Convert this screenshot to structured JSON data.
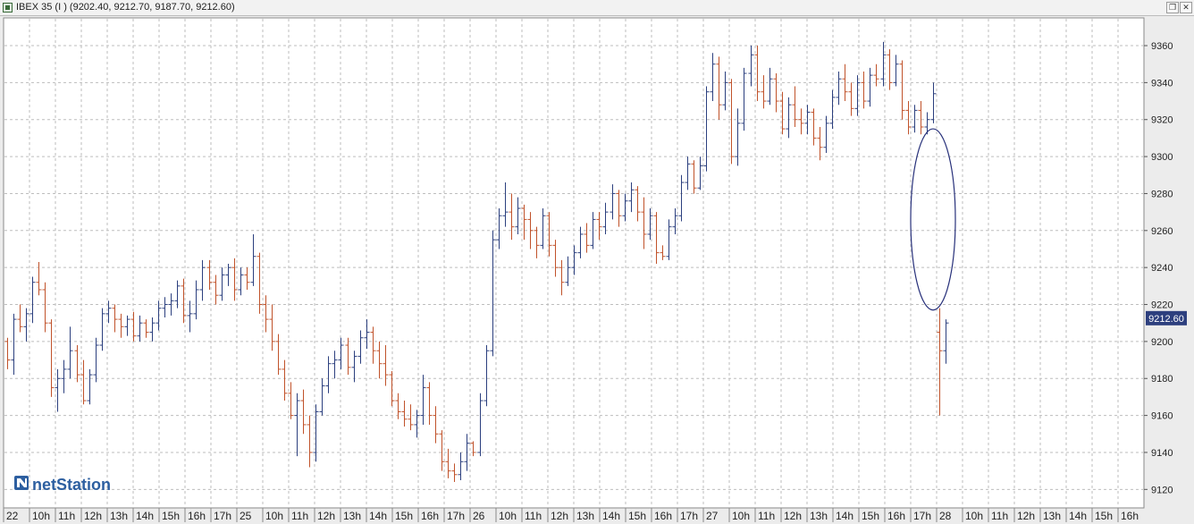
{
  "window": {
    "title": "IBEX 35 (I ) (9202.40, 9212.70, 9187.70, 9212.60)",
    "restore_glyph": "❐",
    "close_glyph": "✕"
  },
  "brand": {
    "name": "netStation",
    "icon": "netstation-n-logo"
  },
  "colors": {
    "up": "#2b3f7e",
    "down": "#c0522a",
    "grid": "#bdbdbd",
    "ellipse": "#27307a",
    "price_tag_bg": "#2d3f7e"
  },
  "chart_data": {
    "type": "ohlc-bar",
    "ylim": [
      9110,
      9375
    ],
    "y_ticks": [
      9120,
      9140,
      9160,
      9180,
      9200,
      9220,
      9240,
      9260,
      9280,
      9300,
      9320,
      9340,
      9360
    ],
    "y_tick_labels": [
      "9120",
      "9140",
      "9160",
      "9180",
      "9200",
      "9220",
      "9240",
      "9260",
      "9280",
      "9300",
      "9320",
      "9340",
      "9360"
    ],
    "last_price": "9212.60",
    "last_price_value": 9212.6,
    "x_labels": [
      "22",
      "10h",
      "11h",
      "12h",
      "13h",
      "14h",
      "15h",
      "16h",
      "17h",
      "25",
      "10h",
      "11h",
      "12h",
      "13h",
      "14h",
      "15h",
      "16h",
      "17h",
      "26",
      "10h",
      "11h",
      "12h",
      "13h",
      "14h",
      "15h",
      "16h",
      "17h",
      "27",
      "10h",
      "11h",
      "12h",
      "13h",
      "14h",
      "15h",
      "16h",
      "17h",
      "28",
      "10h",
      "11h",
      "12h",
      "13h",
      "14h",
      "15h",
      "16h"
    ],
    "grid": true,
    "bars": [
      [
        9200,
        9202,
        9185,
        9190
      ],
      [
        9190,
        9215,
        9182,
        9212
      ],
      [
        9212,
        9220,
        9205,
        9208
      ],
      [
        9208,
        9218,
        9200,
        9215
      ],
      [
        9215,
        9235,
        9210,
        9232
      ],
      [
        9232,
        9243,
        9225,
        9228
      ],
      [
        9228,
        9232,
        9205,
        9210
      ],
      [
        9210,
        9212,
        9170,
        9175
      ],
      [
        9175,
        9185,
        9162,
        9180
      ],
      [
        9180,
        9190,
        9172,
        9185
      ],
      [
        9185,
        9208,
        9180,
        9195
      ],
      [
        9195,
        9198,
        9178,
        9182
      ],
      [
        9182,
        9190,
        9166,
        9168
      ],
      [
        9168,
        9185,
        9166,
        9182
      ],
      [
        9182,
        9202,
        9178,
        9198
      ],
      [
        9198,
        9218,
        9195,
        9215
      ],
      [
        9215,
        9222,
        9210,
        9218
      ],
      [
        9218,
        9220,
        9205,
        9212
      ],
      [
        9212,
        9215,
        9202,
        9208
      ],
      [
        9208,
        9214,
        9203,
        9212
      ],
      [
        9212,
        9216,
        9200,
        9203
      ],
      [
        9203,
        9214,
        9200,
        9210
      ],
      [
        9210,
        9212,
        9202,
        9205
      ],
      [
        9205,
        9213,
        9200,
        9210
      ],
      [
        9210,
        9222,
        9206,
        9218
      ],
      [
        9218,
        9224,
        9213,
        9220
      ],
      [
        9220,
        9226,
        9214,
        9222
      ],
      [
        9222,
        9233,
        9218,
        9230
      ],
      [
        9230,
        9234,
        9210,
        9214
      ],
      [
        9214,
        9222,
        9205,
        9215
      ],
      [
        9215,
        9233,
        9212,
        9228
      ],
      [
        9228,
        9244,
        9222,
        9240
      ],
      [
        9240,
        9244,
        9228,
        9232
      ],
      [
        9232,
        9236,
        9220,
        9225
      ],
      [
        9225,
        9240,
        9222,
        9236
      ],
      [
        9236,
        9242,
        9230,
        9240
      ],
      [
        9240,
        9245,
        9222,
        9228
      ],
      [
        9228,
        9240,
        9225,
        9236
      ],
      [
        9236,
        9240,
        9228,
        9232
      ],
      [
        9232,
        9258,
        9230,
        9246
      ],
      [
        9246,
        9248,
        9215,
        9220
      ],
      [
        9220,
        9225,
        9205,
        9212
      ],
      [
        9212,
        9220,
        9195,
        9200
      ],
      [
        9200,
        9204,
        9182,
        9185
      ],
      [
        9185,
        9190,
        9168,
        9172
      ],
      [
        9172,
        9178,
        9158,
        9160
      ],
      [
        9160,
        9172,
        9138,
        9168
      ],
      [
        9168,
        9174,
        9150,
        9155
      ],
      [
        9155,
        9160,
        9132,
        9140
      ],
      [
        9140,
        9166,
        9135,
        9162
      ],
      [
        9162,
        9180,
        9160,
        9176
      ],
      [
        9176,
        9192,
        9172,
        9188
      ],
      [
        9188,
        9195,
        9180,
        9190
      ],
      [
        9190,
        9202,
        9185,
        9198
      ],
      [
        9198,
        9202,
        9182,
        9186
      ],
      [
        9186,
        9195,
        9178,
        9192
      ],
      [
        9192,
        9206,
        9188,
        9202
      ],
      [
        9202,
        9212,
        9196,
        9205
      ],
      [
        9205,
        9208,
        9188,
        9195
      ],
      [
        9195,
        9200,
        9180,
        9188
      ],
      [
        9188,
        9198,
        9176,
        9182
      ],
      [
        9182,
        9184,
        9165,
        9168
      ],
      [
        9168,
        9172,
        9158,
        9162
      ],
      [
        9162,
        9168,
        9154,
        9158
      ],
      [
        9158,
        9166,
        9152,
        9155
      ],
      [
        9155,
        9163,
        9148,
        9160
      ],
      [
        9160,
        9182,
        9155,
        9175
      ],
      [
        9175,
        9178,
        9155,
        9160
      ],
      [
        9160,
        9165,
        9145,
        9150
      ],
      [
        9150,
        9152,
        9130,
        9135
      ],
      [
        9135,
        9142,
        9126,
        9130
      ],
      [
        9130,
        9134,
        9124,
        9128
      ],
      [
        9128,
        9140,
        9125,
        9135
      ],
      [
        9135,
        9150,
        9130,
        9145
      ],
      [
        9145,
        9146,
        9138,
        9140
      ],
      [
        9140,
        9172,
        9138,
        9168
      ],
      [
        9168,
        9198,
        9165,
        9195
      ],
      [
        9195,
        9260,
        9192,
        9255
      ],
      [
        9255,
        9272,
        9250,
        9268
      ],
      [
        9268,
        9286,
        9262,
        9270
      ],
      [
        9270,
        9280,
        9255,
        9262
      ],
      [
        9262,
        9278,
        9258,
        9272
      ],
      [
        9272,
        9274,
        9255,
        9266
      ],
      [
        9266,
        9270,
        9250,
        9260
      ],
      [
        9260,
        9262,
        9245,
        9252
      ],
      [
        9252,
        9272,
        9250,
        9268
      ],
      [
        9268,
        9270,
        9246,
        9252
      ],
      [
        9252,
        9255,
        9235,
        9240
      ],
      [
        9240,
        9244,
        9225,
        9232
      ],
      [
        9232,
        9246,
        9230,
        9240
      ],
      [
        9240,
        9252,
        9236,
        9248
      ],
      [
        9248,
        9262,
        9245,
        9258
      ],
      [
        9258,
        9264,
        9248,
        9252
      ],
      [
        9252,
        9270,
        9250,
        9266
      ],
      [
        9266,
        9270,
        9255,
        9262
      ],
      [
        9262,
        9275,
        9258,
        9270
      ],
      [
        9270,
        9285,
        9266,
        9280
      ],
      [
        9280,
        9282,
        9262,
        9268
      ],
      [
        9268,
        9280,
        9265,
        9276
      ],
      [
        9276,
        9286,
        9270,
        9282
      ],
      [
        9282,
        9284,
        9265,
        9270
      ],
      [
        9270,
        9278,
        9250,
        9258
      ],
      [
        9258,
        9272,
        9255,
        9268
      ],
      [
        9268,
        9270,
        9242,
        9248
      ],
      [
        9248,
        9252,
        9244,
        9246
      ],
      [
        9246,
        9266,
        9244,
        9262
      ],
      [
        9262,
        9272,
        9258,
        9268
      ],
      [
        9268,
        9290,
        9265,
        9286
      ],
      [
        9286,
        9300,
        9282,
        9296
      ],
      [
        9296,
        9298,
        9280,
        9283
      ],
      [
        9283,
        9300,
        9282,
        9295
      ],
      [
        9295,
        9338,
        9292,
        9335
      ],
      [
        9335,
        9356,
        9330,
        9350
      ],
      [
        9350,
        9354,
        9320,
        9328
      ],
      [
        9328,
        9346,
        9325,
        9340
      ],
      [
        9340,
        9342,
        9296,
        9300
      ],
      [
        9300,
        9326,
        9295,
        9318
      ],
      [
        9318,
        9348,
        9314,
        9345
      ],
      [
        9345,
        9360,
        9338,
        9355
      ],
      [
        9355,
        9360,
        9330,
        9335
      ],
      [
        9335,
        9344,
        9326,
        9330
      ],
      [
        9330,
        9348,
        9328,
        9342
      ],
      [
        9342,
        9345,
        9324,
        9330
      ],
      [
        9330,
        9335,
        9312,
        9315
      ],
      [
        9315,
        9332,
        9310,
        9328
      ],
      [
        9328,
        9338,
        9316,
        9320
      ],
      [
        9320,
        9326,
        9312,
        9318
      ],
      [
        9318,
        9328,
        9312,
        9324
      ],
      [
        9324,
        9326,
        9306,
        9310
      ],
      [
        9310,
        9316,
        9298,
        9305
      ],
      [
        9305,
        9322,
        9302,
        9318
      ],
      [
        9318,
        9336,
        9315,
        9332
      ],
      [
        9332,
        9346,
        9328,
        9342
      ],
      [
        9342,
        9350,
        9330,
        9335
      ],
      [
        9335,
        9340,
        9322,
        9326
      ],
      [
        9326,
        9344,
        9322,
        9340
      ],
      [
        9340,
        9346,
        9326,
        9330
      ],
      [
        9330,
        9348,
        9327,
        9344
      ],
      [
        9344,
        9350,
        9338,
        9342
      ],
      [
        9342,
        9362,
        9338,
        9355
      ],
      [
        9355,
        9358,
        9336,
        9340
      ],
      [
        9340,
        9355,
        9338,
        9350
      ],
      [
        9350,
        9352,
        9320,
        9325
      ],
      [
        9325,
        9330,
        9312,
        9316
      ],
      [
        9316,
        9328,
        9313,
        9325
      ],
      [
        9325,
        9330,
        9312,
        9316
      ],
      [
        9316,
        9324,
        9312,
        9320
      ],
      [
        9320,
        9340,
        9318,
        9334
      ],
      [
        9205,
        9218,
        9160,
        9195
      ],
      [
        9195,
        9212,
        9188,
        9210
      ]
    ],
    "annotations": [
      {
        "type": "ellipse",
        "around": "gap-down at 28 open",
        "y_range": [
          9217,
          9315
        ]
      }
    ]
  }
}
